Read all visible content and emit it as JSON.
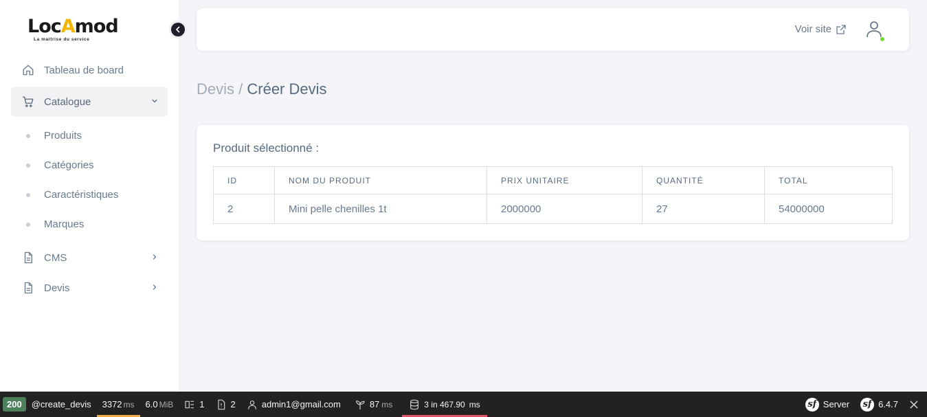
{
  "logo": {
    "text_before": "Loc",
    "text_mark": "A",
    "text_after": "mod",
    "tagline": "La maîtrise du service"
  },
  "sidebar": {
    "items": [
      {
        "label": "Tableau de board",
        "icon": "home-icon"
      },
      {
        "label": "Catalogue",
        "icon": "cart-icon",
        "expanded": true,
        "children": [
          {
            "label": "Produits"
          },
          {
            "label": "Catégories"
          },
          {
            "label": "Caractéristiques"
          },
          {
            "label": "Marques"
          }
        ]
      },
      {
        "label": "CMS",
        "icon": "file-icon"
      },
      {
        "label": "Devis",
        "icon": "file-icon"
      }
    ]
  },
  "navbar": {
    "voir_site": "Voir site"
  },
  "breadcrumb": {
    "parent": "Devis /",
    "current": "Créer Devis"
  },
  "card": {
    "title": "Produit sélectionné :",
    "table": {
      "headers": [
        "ID",
        "NOM DU PRODUIT",
        "PRIX UNITAIRE",
        "QUANTITÉ",
        "TOTAL"
      ],
      "rows": [
        [
          "2",
          "Mini pelle chenilles 1t",
          "2000000",
          "27",
          "54000000"
        ]
      ]
    }
  },
  "toolbar": {
    "status": "200",
    "route": "@create_devis",
    "time_value": "3372",
    "time_unit": "ms",
    "memory_value": "6.0",
    "memory_unit": "MiB",
    "forms_count": "1",
    "logs_count": "2",
    "user": "admin1@gmail.com",
    "twig_value": "87",
    "twig_unit": "ms",
    "db_value": "3 in 467.90",
    "db_unit": "ms",
    "server_label": "Server",
    "version": "6.4.7"
  },
  "colors": {
    "accent_status": "#4f805d",
    "online": "#71dd37",
    "logo_mark": "#f2b705"
  }
}
